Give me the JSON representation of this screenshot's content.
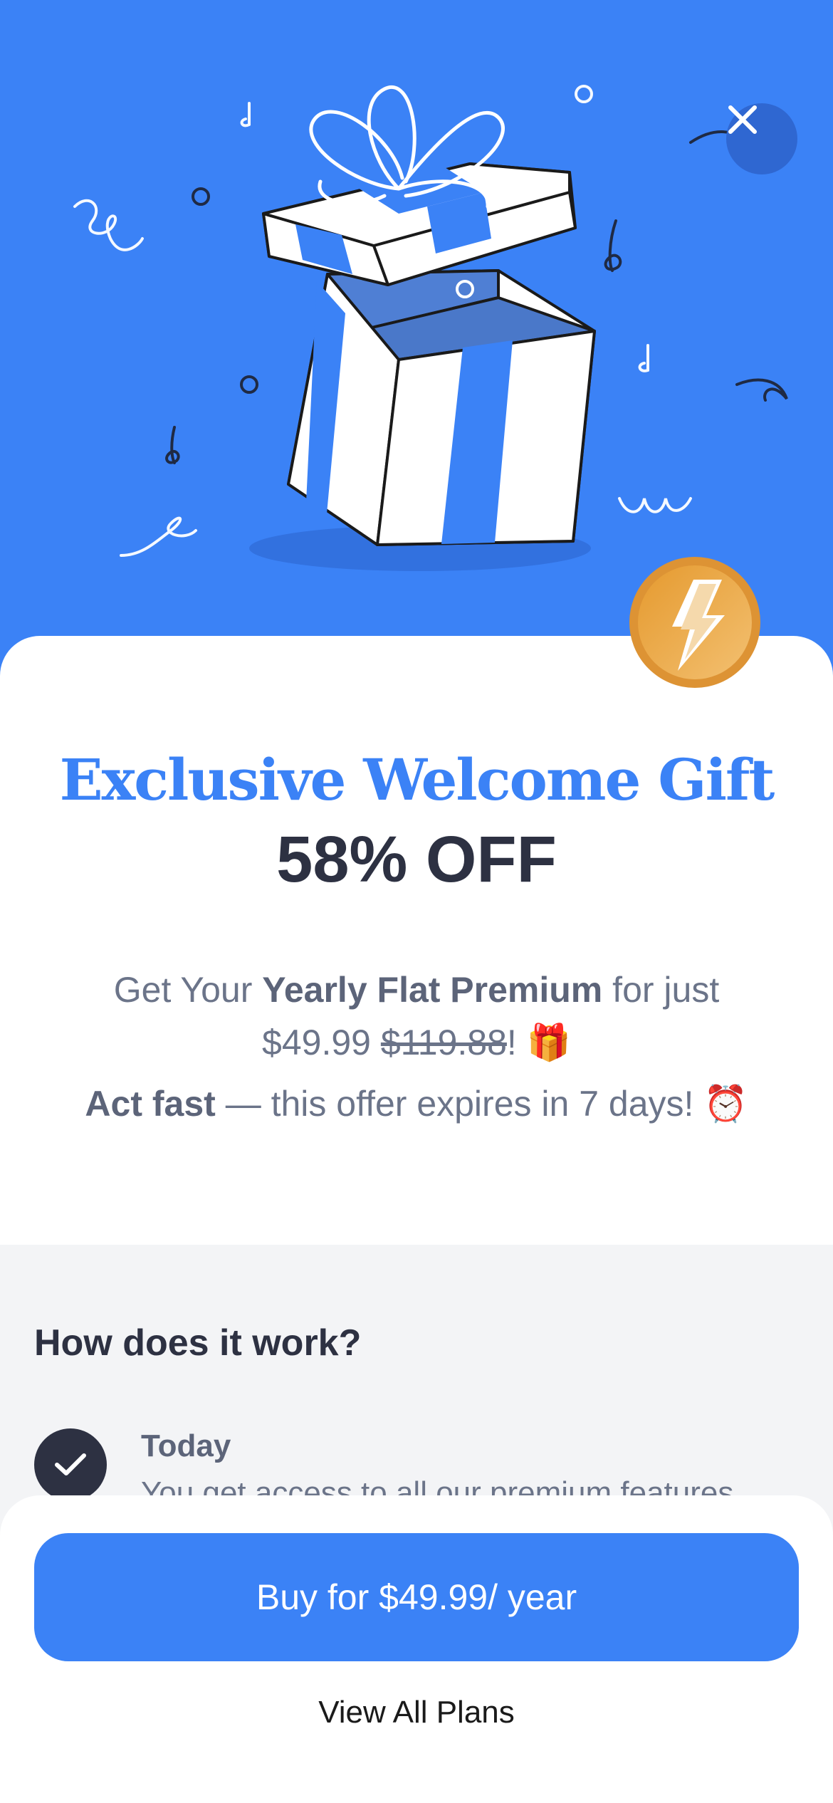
{
  "offer": {
    "title": "Exclusive Welcome Gift",
    "discount": "58% OFF",
    "line1_prefix": "Get Your ",
    "line1_plan": "Yearly Flat Premium",
    "line1_suffix": " for just",
    "new_price": "$49.99",
    "old_price": "$119.88",
    "price_end": "! 🎁",
    "urgency_bold": "Act fast",
    "urgency_rest": " — this offer expires in 7 days! ⏰"
  },
  "how_it_works": {
    "title": "How does it work?",
    "steps": [
      {
        "title": "Today",
        "description": "You get access to all our premium features"
      }
    ]
  },
  "footer": {
    "buy_label": "Buy for $49.99/ year",
    "view_plans_label": "View All Plans"
  },
  "icons": {
    "close": "close-icon",
    "gift": "gift-box-illustration",
    "badge": "lightning-bolt-icon",
    "check": "checkmark-icon"
  },
  "colors": {
    "hero_background": "#3b82f6",
    "accent": "#3b82f6",
    "heading": "#2d3142",
    "body_text": "#6b7489",
    "badge": "#e8a23a",
    "section_background": "#f3f4f6"
  }
}
